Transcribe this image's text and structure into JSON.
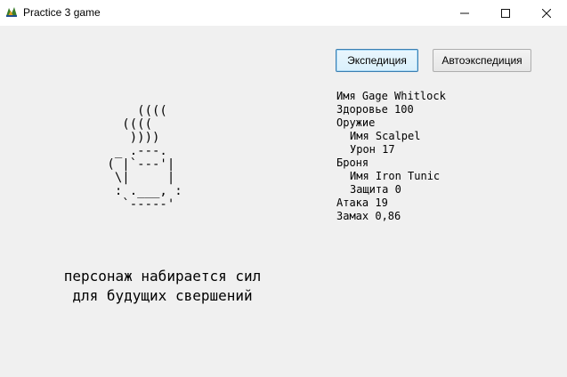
{
  "window": {
    "title": "Practice 3 game",
    "icon": "app-icon",
    "controls": [
      "minimize-icon",
      "maximize-icon",
      "close-icon"
    ]
  },
  "buttons": {
    "expedition": "Экспедиция",
    "auto_expedition": "Автоэкспедиция"
  },
  "ascii_art": "     ((((\n   ((((\n    ))))\n  _ .---.\n ( |`---'|\n  \\|     |\n  : .___, :\n   `-----'",
  "caption": {
    "line1": "персонаж набирается сил",
    "line2": "для будущих свершений"
  },
  "stats": {
    "name": "Имя Gage Whitlock",
    "health": "Здоровье 100",
    "weapon_header": "Оружие",
    "weapon_name": "Имя Scalpel",
    "weapon_damage": "Урон 17",
    "armor_header": "Броня",
    "armor_name": "Имя Iron Tunic",
    "armor_defense": "Защита 0",
    "attack": "Атака 19",
    "swing": "Замах 0,86"
  }
}
